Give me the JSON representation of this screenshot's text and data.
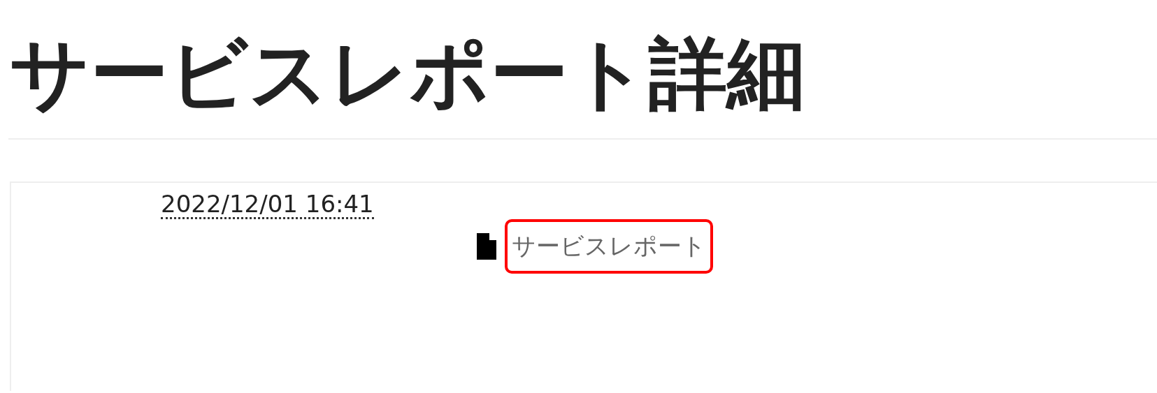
{
  "page_title": "サービスレポート詳細",
  "entry": {
    "timestamp": "2022/12/01 16:41",
    "attachment": {
      "label": "サービスレポート",
      "highlighted": true
    }
  }
}
